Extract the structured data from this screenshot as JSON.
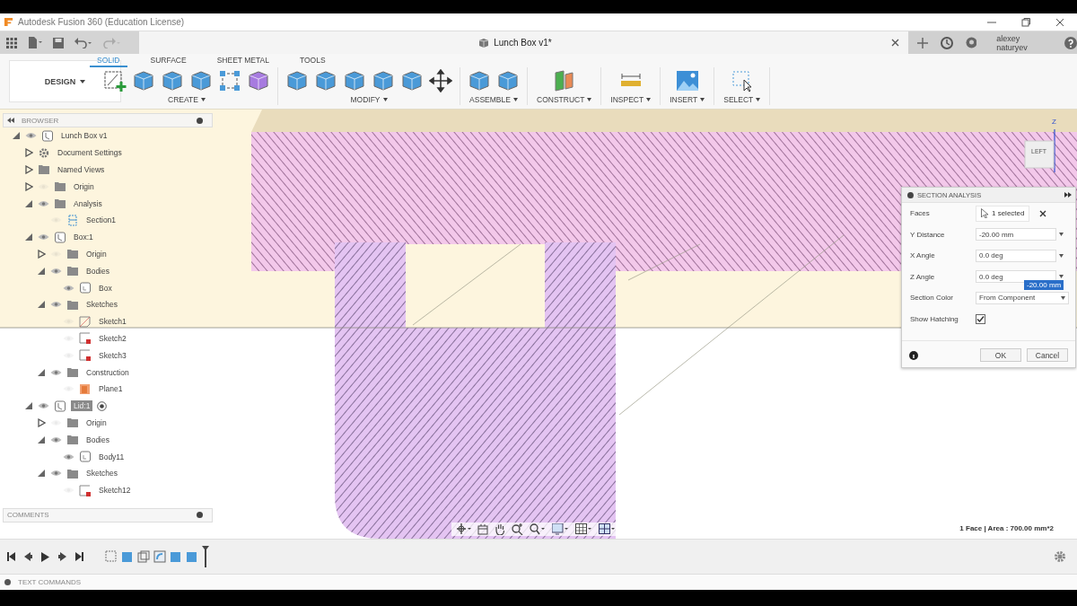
{
  "window": {
    "title": "Autodesk Fusion 360 (Education License)"
  },
  "document_tab": {
    "title": "Lunch Box v1*"
  },
  "user": {
    "name": "alexey naturyev"
  },
  "workspace": {
    "label": "DESIGN"
  },
  "ribbon_tabs": [
    {
      "label": "SOLID",
      "selected": true
    },
    {
      "label": "SURFACE",
      "selected": false
    },
    {
      "label": "SHEET METAL",
      "selected": false
    },
    {
      "label": "TOOLS",
      "selected": false
    }
  ],
  "ribbon_groups": [
    {
      "label": "CREATE"
    },
    {
      "label": "MODIFY"
    },
    {
      "label": "ASSEMBLE"
    },
    {
      "label": "CONSTRUCT"
    },
    {
      "label": "INSPECT"
    },
    {
      "label": "INSERT"
    },
    {
      "label": "SELECT"
    }
  ],
  "browser": {
    "title": "BROWSER",
    "items": [
      {
        "label": "Lunch Box v1",
        "kind": "document",
        "visible": true,
        "expanded": true,
        "selected": false,
        "children": [
          {
            "label": "Document Settings",
            "kind": "gear",
            "expanded": false,
            "selected": false
          },
          {
            "label": "Named Views",
            "kind": "folder",
            "expanded": false,
            "selected": false
          },
          {
            "label": "Origin",
            "kind": "folder",
            "visible": false,
            "expanded": false,
            "selected": false
          },
          {
            "label": "Analysis",
            "kind": "folder",
            "visible": true,
            "expanded": true,
            "selected": false,
            "children": [
              {
                "label": "Section1",
                "kind": "section",
                "visible": false,
                "selected": false
              }
            ]
          },
          {
            "label": "Box:1",
            "kind": "component",
            "visible": true,
            "expanded": true,
            "selected": false,
            "children": [
              {
                "label": "Origin",
                "kind": "folder",
                "visible": false,
                "expanded": false,
                "selected": false
              },
              {
                "label": "Bodies",
                "kind": "folder",
                "visible": true,
                "expanded": true,
                "selected": false,
                "children": [
                  {
                    "label": "Box",
                    "kind": "body",
                    "visible": true,
                    "selected": false
                  }
                ]
              },
              {
                "label": "Sketches",
                "kind": "folder",
                "visible": true,
                "expanded": true,
                "selected": false,
                "children": [
                  {
                    "label": "Sketch1",
                    "kind": "sketch",
                    "visible": false,
                    "selected": false
                  },
                  {
                    "label": "Sketch2",
                    "kind": "sketch-locked",
                    "visible": false,
                    "selected": false
                  },
                  {
                    "label": "Sketch3",
                    "kind": "sketch-locked",
                    "visible": false,
                    "selected": false
                  }
                ]
              },
              {
                "label": "Construction",
                "kind": "folder",
                "visible": true,
                "expanded": true,
                "selected": false,
                "children": [
                  {
                    "label": "Plane1",
                    "kind": "plane",
                    "visible": false,
                    "selected": false
                  }
                ]
              }
            ]
          },
          {
            "label": "Lid:1",
            "kind": "component",
            "visible": true,
            "expanded": true,
            "active": true,
            "selected": true,
            "children": [
              {
                "label": "Origin",
                "kind": "folder",
                "visible": false,
                "expanded": false,
                "selected": false
              },
              {
                "label": "Bodies",
                "kind": "folder",
                "visible": true,
                "expanded": true,
                "selected": false,
                "children": [
                  {
                    "label": "Body11",
                    "kind": "body",
                    "visible": true,
                    "selected": false
                  }
                ]
              },
              {
                "label": "Sketches",
                "kind": "folder",
                "visible": true,
                "expanded": true,
                "selected": false,
                "children": [
                  {
                    "label": "Sketch12",
                    "kind": "sketch-locked",
                    "visible": false,
                    "selected": false
                  }
                ]
              }
            ]
          }
        ]
      }
    ]
  },
  "comments": {
    "title": "COMMENTS"
  },
  "section_analysis": {
    "title": "SECTION ANALYSIS",
    "rows": [
      {
        "kind": "selection",
        "label": "Faces",
        "value": "1 selected"
      },
      {
        "kind": "input",
        "label": "Y Distance",
        "value": "-20.00 mm"
      },
      {
        "kind": "input",
        "label": "X Angle",
        "value": "0.0 deg"
      },
      {
        "kind": "input",
        "label": "Z Angle",
        "value": "0.0 deg"
      },
      {
        "kind": "dropdown",
        "label": "Section Color",
        "value": "From Component"
      },
      {
        "kind": "checkbox",
        "label": "Show Hatching",
        "checked": true
      }
    ],
    "edit_value": "-20.00 mm",
    "buttons": [
      "OK",
      "Cancel"
    ]
  },
  "view_cube": {
    "axis": "Z",
    "face": "LEFT"
  },
  "status": {
    "text": "1 Face | Area : 700.00 mm*2"
  },
  "text_commands": {
    "label": "TEXT COMMANDS"
  }
}
